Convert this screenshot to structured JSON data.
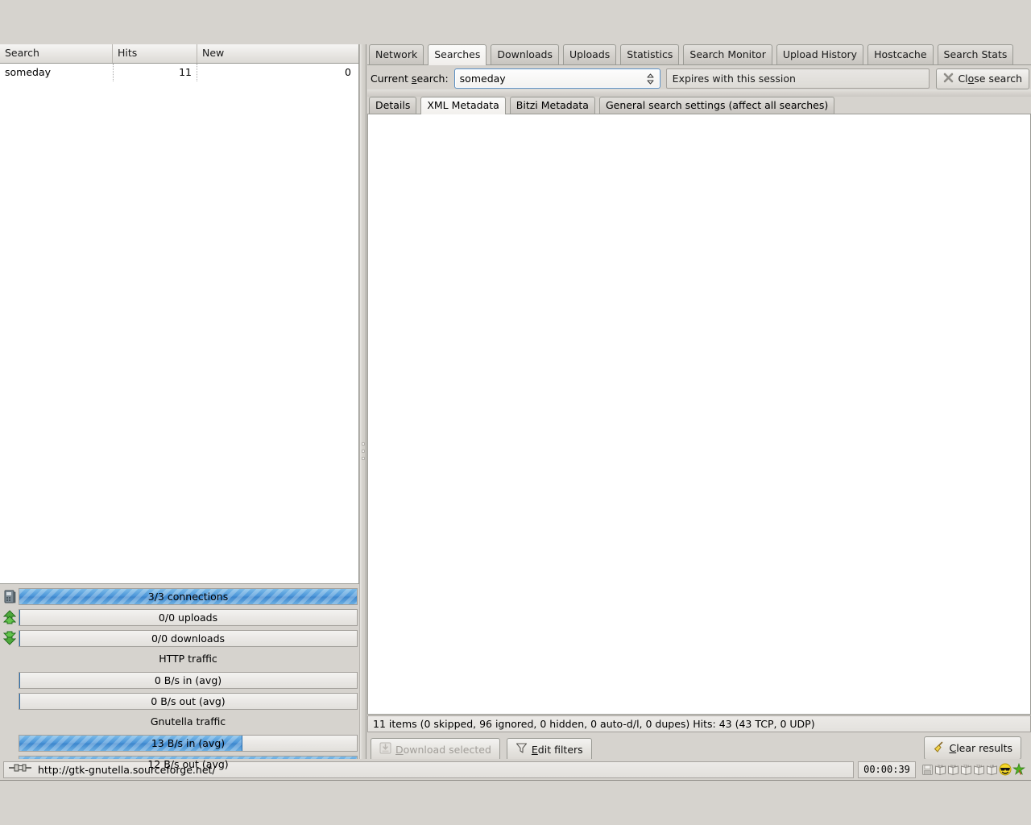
{
  "search_list": {
    "columns": [
      "Search",
      "Hits",
      "New"
    ],
    "rows": [
      {
        "search": "someday",
        "hits": "11",
        "new": "0"
      }
    ]
  },
  "stats": {
    "connections": {
      "label": "3/3 connections",
      "fill_pct": 100,
      "icon": "server-icon"
    },
    "uploads": {
      "label": "0/0 uploads",
      "fill_pct": 0,
      "icon": "upload-arrows-icon"
    },
    "downloads": {
      "label": "0/0 downloads",
      "fill_pct": 0,
      "icon": "download-arrows-icon"
    },
    "http_header": "HTTP traffic",
    "http_in": {
      "label": "0 B/s in (avg)",
      "fill_pct": 0
    },
    "http_out": {
      "label": "0 B/s out (avg)",
      "fill_pct": 0
    },
    "gnutella_header": "Gnutella traffic",
    "gnutella_in": {
      "label": "13 B/s in (avg)",
      "fill_pct": 66
    },
    "gnutella_out": {
      "label": "12 B/s out (avg)",
      "fill_pct": 100
    }
  },
  "main_tabs": [
    {
      "label": "Network",
      "active": false
    },
    {
      "label": "Searches",
      "active": true
    },
    {
      "label": "Downloads",
      "active": false
    },
    {
      "label": "Uploads",
      "active": false
    },
    {
      "label": "Statistics",
      "active": false
    },
    {
      "label": "Search Monitor",
      "active": false
    },
    {
      "label": "Upload History",
      "active": false
    },
    {
      "label": "Hostcache",
      "active": false
    },
    {
      "label": "Search Stats",
      "active": false
    }
  ],
  "search_bar": {
    "label": "Current search:",
    "current_search": "someday",
    "expiry": "Expires with this session",
    "close_button": "Close search"
  },
  "sub_tabs": [
    {
      "label": "Details",
      "active": false
    },
    {
      "label": "XML Metadata",
      "active": true
    },
    {
      "label": "Bitzi Metadata",
      "active": false
    },
    {
      "label": "General search settings (affect all searches)",
      "active": false
    }
  ],
  "results": {
    "status": "11 items (0 skipped, 96 ignored, 0 hidden, 0 auto-d/l, 0 dupes) Hits: 43 (43 TCP, 0 UDP)",
    "download_button": "Download selected",
    "download_disabled": true,
    "edit_filters_button": "Edit filters",
    "clear_results_button": "Clear results"
  },
  "statusbar": {
    "url": "http://gtk-gnutella.sourceforge.net/",
    "clock": "00:00:39",
    "icons": [
      "disk-save-icon",
      "sha-book-icon",
      "sha-book-icon",
      "tth-book-icon",
      "tth-book-icon",
      "lib-book-icon",
      "smiley-sunglasses-icon",
      "green-star-icon"
    ]
  },
  "colors": {
    "accent": "#4a94d8",
    "chrome": "#d6d3ce",
    "border": "#9a9a94"
  }
}
